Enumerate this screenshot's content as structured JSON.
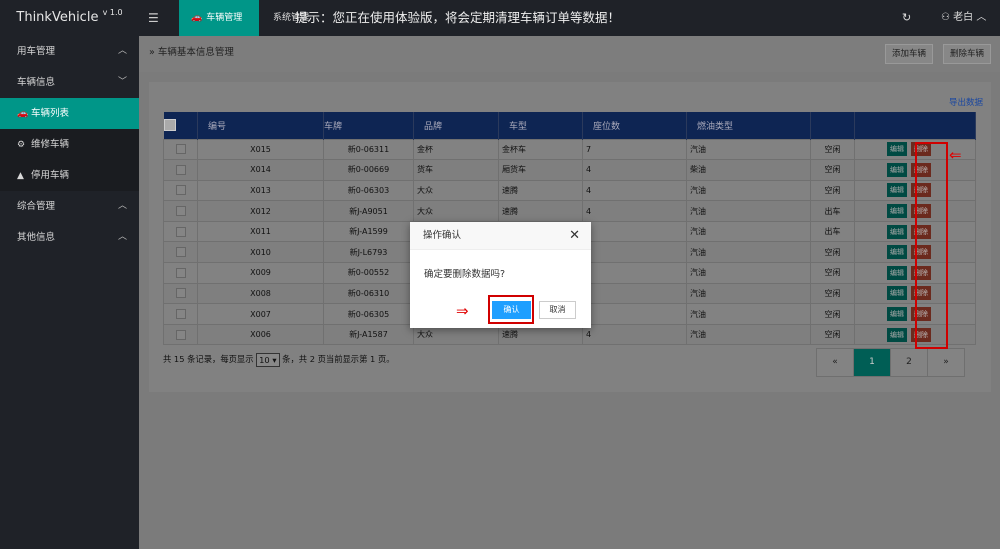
{
  "topbar": {
    "brand": "ThinkVehicle",
    "version": "v 1.0",
    "menu_toggle": "☰",
    "active_tab": "车辆管理",
    "other_tab": "系统管理",
    "notice": "提示：您正在使用体验版，将会定期清理车辆订单等数据！",
    "user": "老白"
  },
  "sidebar": {
    "groups": [
      {
        "label": "用车管理",
        "chevron": "up"
      },
      {
        "label": "车辆信息",
        "chevron": "down"
      }
    ],
    "sub_items": [
      {
        "label": "车辆列表",
        "icon": "car-icon",
        "active": true
      },
      {
        "label": "维修车辆",
        "icon": "gear-icon",
        "active": false
      },
      {
        "label": "停用车辆",
        "icon": "warning-icon",
        "active": false
      }
    ],
    "groups_after": [
      {
        "label": "综合管理",
        "chevron": "up"
      },
      {
        "label": "其他信息",
        "chevron": "up"
      }
    ]
  },
  "breadcrumb": "车辆基本信息管理",
  "header_buttons": {
    "add": "添加车辆",
    "delete": "删除车辆"
  },
  "export_label": "导出数据",
  "table": {
    "columns": [
      "编号",
      "车牌",
      "品牌",
      "车型",
      "座位数",
      "燃油类型",
      "",
      ""
    ],
    "rows": [
      {
        "id": "X015",
        "plate": "新0-06311",
        "brand": "金杯",
        "model": "金杯车",
        "seats": "7",
        "fuel": "汽油",
        "status": "空闲"
      },
      {
        "id": "X014",
        "plate": "新0-00669",
        "brand": "货车",
        "model": "厢货车",
        "seats": "4",
        "fuel": "柴油",
        "status": "空闲"
      },
      {
        "id": "X013",
        "plate": "新0-06303",
        "brand": "大众",
        "model": "速腾",
        "seats": "4",
        "fuel": "汽油",
        "status": "空闲"
      },
      {
        "id": "X012",
        "plate": "新J-A9051",
        "brand": "大众",
        "model": "速腾",
        "seats": "4",
        "fuel": "汽油",
        "status": "出车"
      },
      {
        "id": "X011",
        "plate": "新J-A1599",
        "brand": "",
        "model": "",
        "seats": "",
        "fuel": "汽油",
        "status": "出车"
      },
      {
        "id": "X010",
        "plate": "新J-L6793",
        "brand": "",
        "model": "",
        "seats": "",
        "fuel": "汽油",
        "status": "空闲"
      },
      {
        "id": "X009",
        "plate": "新0-00552",
        "brand": "",
        "model": "",
        "seats": "",
        "fuel": "汽油",
        "status": "空闲"
      },
      {
        "id": "X008",
        "plate": "新0-06310",
        "brand": "",
        "model": "",
        "seats": "",
        "fuel": "汽油",
        "status": "空闲"
      },
      {
        "id": "X007",
        "plate": "新0-06305",
        "brand": "",
        "model": "",
        "seats": "",
        "fuel": "汽油",
        "status": "空闲"
      },
      {
        "id": "X006",
        "plate": "新J-A1587",
        "brand": "大众",
        "model": "速腾",
        "seats": "4",
        "fuel": "汽油",
        "status": "空闲"
      }
    ],
    "edit_label": "编辑",
    "delete_label": "删除"
  },
  "footer": {
    "prefix": "共 15 条记录，每页显示",
    "page_size": "10 ▾",
    "suffix": "条，共 2 页当前显示第 1 页。"
  },
  "pager": {
    "prev": "«",
    "pages": [
      "1",
      "2"
    ],
    "next": "»",
    "current": "1"
  },
  "dialog": {
    "title": "操作确认",
    "close": "✕",
    "message": "确定要删除数据吗?",
    "ok": "确认",
    "cancel": "取消"
  },
  "colors": {
    "accent": "#009688",
    "primary": "#1e9fff",
    "highlight": "#d00000"
  }
}
